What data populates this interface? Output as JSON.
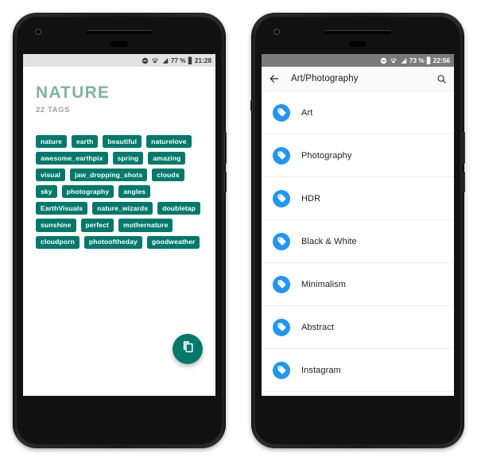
{
  "phones": {
    "left": {
      "status_bar": {
        "dnd_icon": "do-not-disturb-icon",
        "wifi_icon": "wifi-icon",
        "signal_icon": "cellular-signal-icon",
        "battery_percent": "77 %",
        "battery_icon": "battery-icon",
        "clock": "21:28"
      },
      "screen": {
        "title": "NATURE",
        "subtitle": "22 TAGS",
        "tags": [
          "nature",
          "earth",
          "beautiful",
          "naturelove",
          "awesome_earthpix",
          "spring",
          "amazing",
          "visual",
          "jaw_dropping_shots",
          "clouds",
          "sky",
          "photography",
          "angles",
          "EarthVisuals",
          "nature_wizards",
          "doubletap",
          "sunshine",
          "perfect",
          "mothernature",
          "cloudporn",
          "photooftheday",
          "goodweather"
        ],
        "fab": {
          "icon": "content-copy-icon",
          "label": "Copy tags"
        }
      }
    },
    "right": {
      "status_bar": {
        "dnd_icon": "do-not-disturb-icon",
        "wifi_icon": "wifi-icon",
        "signal_icon": "cellular-signal-icon",
        "battery_percent": "73 %",
        "battery_icon": "battery-icon",
        "clock": "22:56"
      },
      "screen": {
        "appbar": {
          "back_icon": "back-arrow-icon",
          "title": "Art/Photography",
          "search_icon": "search-icon"
        },
        "list_items": [
          {
            "label": "Art",
            "icon": "tag-icon"
          },
          {
            "label": "Photography",
            "icon": "tag-icon"
          },
          {
            "label": "HDR",
            "icon": "tag-icon"
          },
          {
            "label": "Black & White",
            "icon": "tag-icon"
          },
          {
            "label": "Minimalism",
            "icon": "tag-icon"
          },
          {
            "label": "Abstract",
            "icon": "tag-icon"
          },
          {
            "label": "Instagram",
            "icon": "tag-icon"
          }
        ]
      }
    }
  },
  "colors": {
    "teal": "#00796B",
    "sage": "#82B39C",
    "blue": "#2196F3",
    "statusbar_light": "#E2E2E2",
    "statusbar_dark": "#7A7A7A",
    "appbar": "#FAFAFA"
  }
}
